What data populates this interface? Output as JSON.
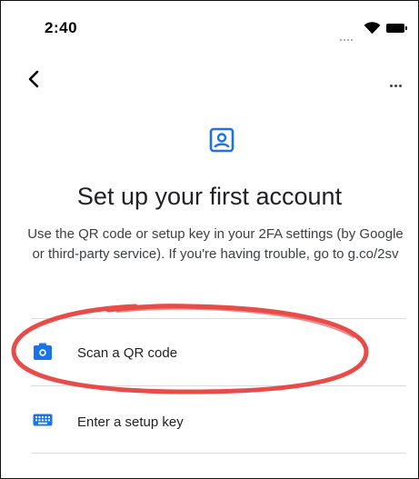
{
  "status_bar": {
    "time": "2:40"
  },
  "nav": {
    "back_icon": "chevron-left-icon",
    "more_icon": "more-horizontal-icon"
  },
  "header": {
    "icon": "account-box-icon",
    "title": "Set up your first account",
    "description": "Use the QR code or setup key in your 2FA settings (by Google or third-party service). If you're having trouble, go to g.co/2sv"
  },
  "options": [
    {
      "label": "Scan a QR code",
      "icon": "camera-icon"
    },
    {
      "label": "Enter a setup key",
      "icon": "keyboard-icon"
    }
  ],
  "colors": {
    "accent": "#1a73e8",
    "highlight_annotation": "#e53935",
    "divider": "#dadce0"
  }
}
